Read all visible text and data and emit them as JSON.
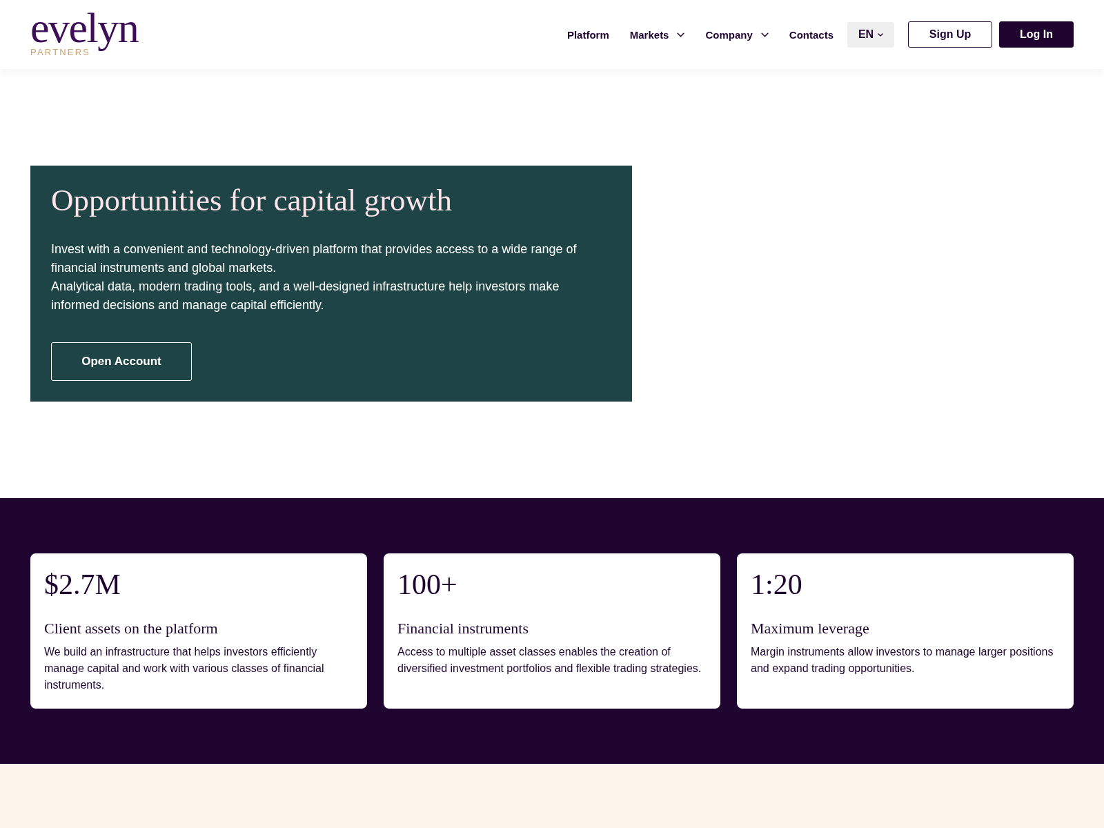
{
  "header": {
    "logo": {
      "wordmark": "evelyn",
      "tagline": "PARTNERS"
    },
    "nav": [
      {
        "label": "Platform",
        "kind": "link"
      },
      {
        "label": "Markets",
        "kind": "dropdown"
      },
      {
        "label": "Company",
        "kind": "dropdown"
      },
      {
        "label": "Contacts",
        "kind": "link"
      }
    ],
    "language": "EN",
    "buttons": [
      {
        "label": "Sign Up",
        "kind": "outline"
      },
      {
        "label": "Log In",
        "kind": "solid"
      }
    ]
  },
  "hero": {
    "title": "Opportunities for capital growth",
    "paragraphs": [
      "Invest with a convenient and technology-driven platform that provides access to a wide range of financial instruments and global markets.",
      "Analytical data, modern trading tools, and a well-designed infrastructure help investors make informed decisions and manage capital efficiently."
    ],
    "button": "Open Account"
  },
  "stats": [
    {
      "value": "$2.7M",
      "title": "Client assets on the platform",
      "text": "We build an infrastructure that helps investors efficiently manage capital and work with various classes of financial instruments."
    },
    {
      "value": "100+",
      "title": "Financial instruments",
      "text": "Access to multiple asset classes enables the creation of diversified investment portfolios and flexible trading strategies."
    },
    {
      "value": "1:20",
      "title": "Maximum leverage",
      "text": "Margin instruments allow investors to manage larger positions and expand trading opportunities."
    }
  ]
}
